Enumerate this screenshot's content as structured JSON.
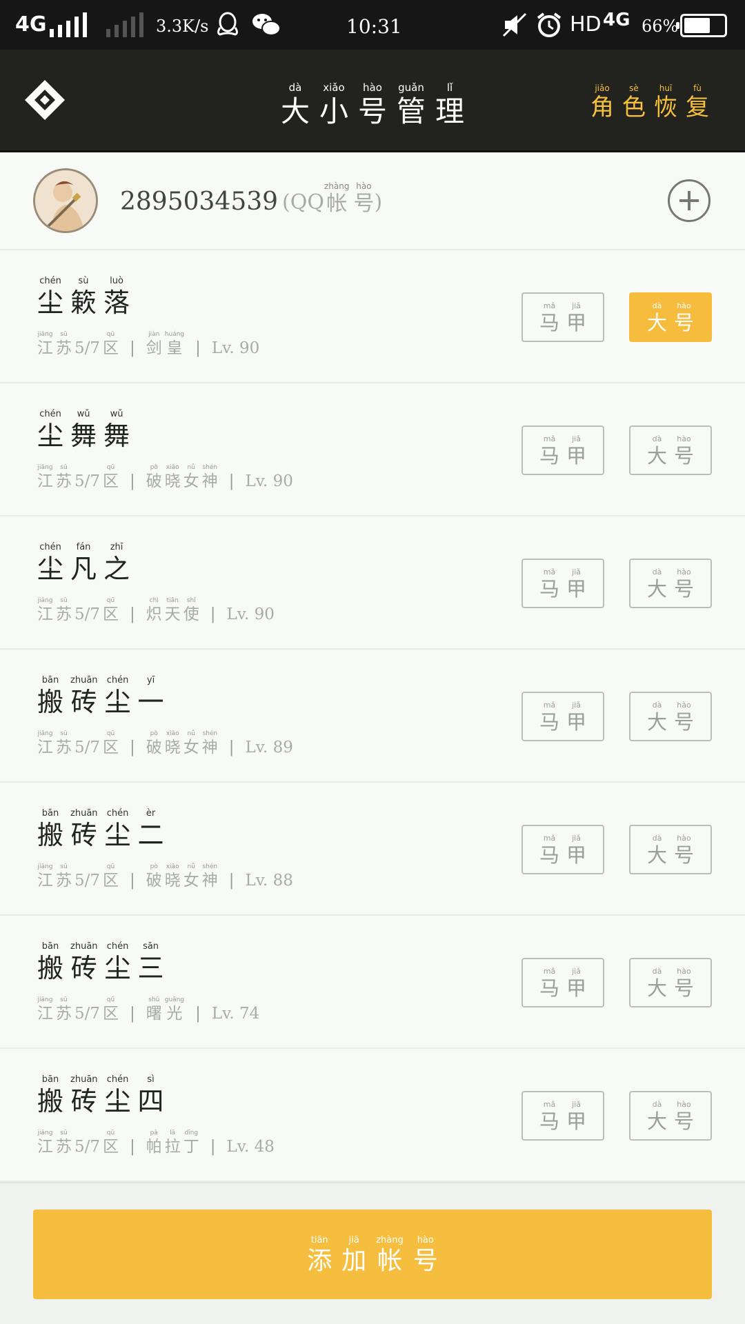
{
  "status_bar": {
    "network": "4G",
    "speed": "3.3K/s",
    "time": "10:31",
    "hd": "HD",
    "network2": "4G",
    "battery_percent": "66%",
    "battery_level": 0.66,
    "icons": [
      "signal-icon",
      "qq-icon",
      "wechat-icon",
      "mute-icon",
      "alarm-icon",
      "battery-icon"
    ]
  },
  "header": {
    "title": [
      {
        "py": "dà",
        "ch": "大"
      },
      {
        "py": "xiǎo",
        "ch": "小"
      },
      {
        "py": "hào",
        "ch": "号"
      },
      {
        "py": "guǎn",
        "ch": "管"
      },
      {
        "py": "lǐ",
        "ch": "理"
      }
    ],
    "restore": [
      {
        "py": "jiǎo",
        "ch": "角"
      },
      {
        "py": "sè",
        "ch": "色"
      },
      {
        "py": "huī",
        "ch": "恢"
      },
      {
        "py": "fù",
        "ch": "复"
      }
    ]
  },
  "account": {
    "number": "2895034539",
    "open_paren": "(QQ",
    "label": [
      {
        "py": "zhàng",
        "ch": "帐"
      },
      {
        "py": "hào",
        "ch": "号"
      }
    ],
    "close_paren": ")"
  },
  "alt_label": [
    {
      "py": "mǎ",
      "ch": "马"
    },
    {
      "py": "jiǎ",
      "ch": "甲"
    }
  ],
  "main_label": [
    {
      "py": "dà",
      "ch": "大"
    },
    {
      "py": "hào",
      "ch": "号"
    }
  ],
  "characters": [
    {
      "name": [
        {
          "py": "chén",
          "ch": "尘"
        },
        {
          "py": "sù",
          "ch": "簌"
        },
        {
          "py": "luò",
          "ch": "落"
        }
      ],
      "server_num": "5/7",
      "class": [
        {
          "py": "jiàn",
          "ch": "剑"
        },
        {
          "py": "huáng",
          "ch": "皇"
        }
      ],
      "level": "Lv. 90",
      "is_main": true
    },
    {
      "name": [
        {
          "py": "chén",
          "ch": "尘"
        },
        {
          "py": "wǔ",
          "ch": "舞"
        },
        {
          "py": "wǔ",
          "ch": "舞"
        }
      ],
      "server_num": "5/7",
      "class": [
        {
          "py": "pò",
          "ch": "破"
        },
        {
          "py": "xiǎo",
          "ch": "晓"
        },
        {
          "py": "nǚ",
          "ch": "女"
        },
        {
          "py": "shén",
          "ch": "神"
        }
      ],
      "level": "Lv. 90",
      "is_main": false
    },
    {
      "name": [
        {
          "py": "chén",
          "ch": "尘"
        },
        {
          "py": "fán",
          "ch": "凡"
        },
        {
          "py": "zhī",
          "ch": "之"
        }
      ],
      "server_num": "5/7",
      "class": [
        {
          "py": "chì",
          "ch": "炽"
        },
        {
          "py": "tiān",
          "ch": "天"
        },
        {
          "py": "shǐ",
          "ch": "使"
        }
      ],
      "level": "Lv. 90",
      "is_main": false
    },
    {
      "name": [
        {
          "py": "bān",
          "ch": "搬"
        },
        {
          "py": "zhuān",
          "ch": "砖"
        },
        {
          "py": "chén",
          "ch": "尘"
        },
        {
          "py": "yī",
          "ch": "一"
        }
      ],
      "server_num": "5/7",
      "class": [
        {
          "py": "pò",
          "ch": "破"
        },
        {
          "py": "xiǎo",
          "ch": "晓"
        },
        {
          "py": "nǚ",
          "ch": "女"
        },
        {
          "py": "shén",
          "ch": "神"
        }
      ],
      "level": "Lv. 89",
      "is_main": false
    },
    {
      "name": [
        {
          "py": "bān",
          "ch": "搬"
        },
        {
          "py": "zhuān",
          "ch": "砖"
        },
        {
          "py": "chén",
          "ch": "尘"
        },
        {
          "py": "èr",
          "ch": "二"
        }
      ],
      "server_num": "5/7",
      "class": [
        {
          "py": "pò",
          "ch": "破"
        },
        {
          "py": "xiǎo",
          "ch": "晓"
        },
        {
          "py": "nǚ",
          "ch": "女"
        },
        {
          "py": "shén",
          "ch": "神"
        }
      ],
      "level": "Lv. 88",
      "is_main": false
    },
    {
      "name": [
        {
          "py": "bān",
          "ch": "搬"
        },
        {
          "py": "zhuān",
          "ch": "砖"
        },
        {
          "py": "chén",
          "ch": "尘"
        },
        {
          "py": "sān",
          "ch": "三"
        }
      ],
      "server_num": "5/7",
      "class": [
        {
          "py": "shǔ",
          "ch": "曙"
        },
        {
          "py": "guāng",
          "ch": "光"
        }
      ],
      "level": "Lv. 74",
      "is_main": false
    },
    {
      "name": [
        {
          "py": "bān",
          "ch": "搬"
        },
        {
          "py": "zhuān",
          "ch": "砖"
        },
        {
          "py": "chén",
          "ch": "尘"
        },
        {
          "py": "sì",
          "ch": "四"
        }
      ],
      "server_num": "5/7",
      "class": [
        {
          "py": "pà",
          "ch": "帕"
        },
        {
          "py": "lā",
          "ch": "拉"
        },
        {
          "py": "dīng",
          "ch": "丁"
        }
      ],
      "level": "Lv. 48",
      "is_main": false
    }
  ],
  "server_prefix": [
    {
      "py": "jiāng",
      "ch": "江"
    },
    {
      "py": "sū",
      "ch": "苏"
    }
  ],
  "server_suffix": {
    "py": "qū",
    "ch": "区"
  },
  "separator": "|",
  "add_account": [
    {
      "py": "tiān",
      "ch": "添"
    },
    {
      "py": "jiā",
      "ch": "加"
    },
    {
      "py": "zhàng",
      "ch": "帐"
    },
    {
      "py": "hào",
      "ch": "号"
    }
  ],
  "colors": {
    "accent": "#f6bc3d",
    "header_bg": "#22221e",
    "statusbar_bg": "#161616"
  }
}
